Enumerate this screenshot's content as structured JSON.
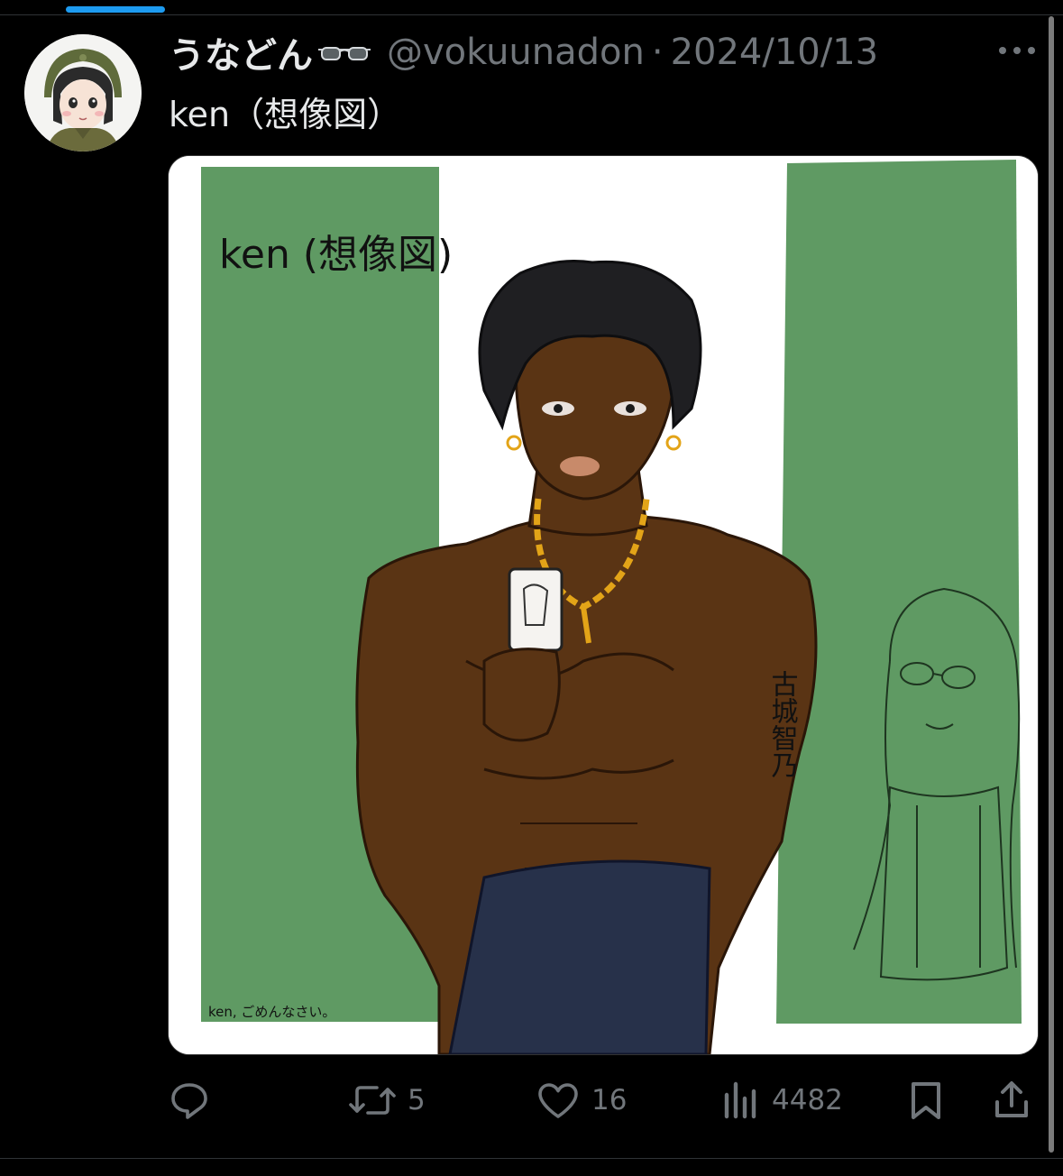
{
  "tweet": {
    "display_name": "うなどん",
    "name_emoji_icon": "sunglasses-icon",
    "handle": "@vokuunadon",
    "separator": "·",
    "date": "2024/10/13",
    "text": "ken（想像図）"
  },
  "media": {
    "drawing_title": "ken (想像図)",
    "drawing_signature": "ken, ごめんなさい。",
    "tattoo_text": "古城智乃"
  },
  "actions": {
    "reply": {
      "icon": "reply-icon",
      "count": ""
    },
    "retweet": {
      "icon": "retweet-icon",
      "count": "5"
    },
    "like": {
      "icon": "heart-icon",
      "count": "16"
    },
    "views": {
      "icon": "views-chart-icon",
      "count": "4482"
    },
    "bookmark": {
      "icon": "bookmark-icon"
    },
    "share": {
      "icon": "share-icon"
    }
  },
  "colors": {
    "accent_blue": "#1d9bf0",
    "muted_text": "#71767b",
    "drawing_green": "#5f9a63",
    "skin": "#5a3414",
    "jeans": "#27314a",
    "chain_gold": "#e3a418"
  }
}
